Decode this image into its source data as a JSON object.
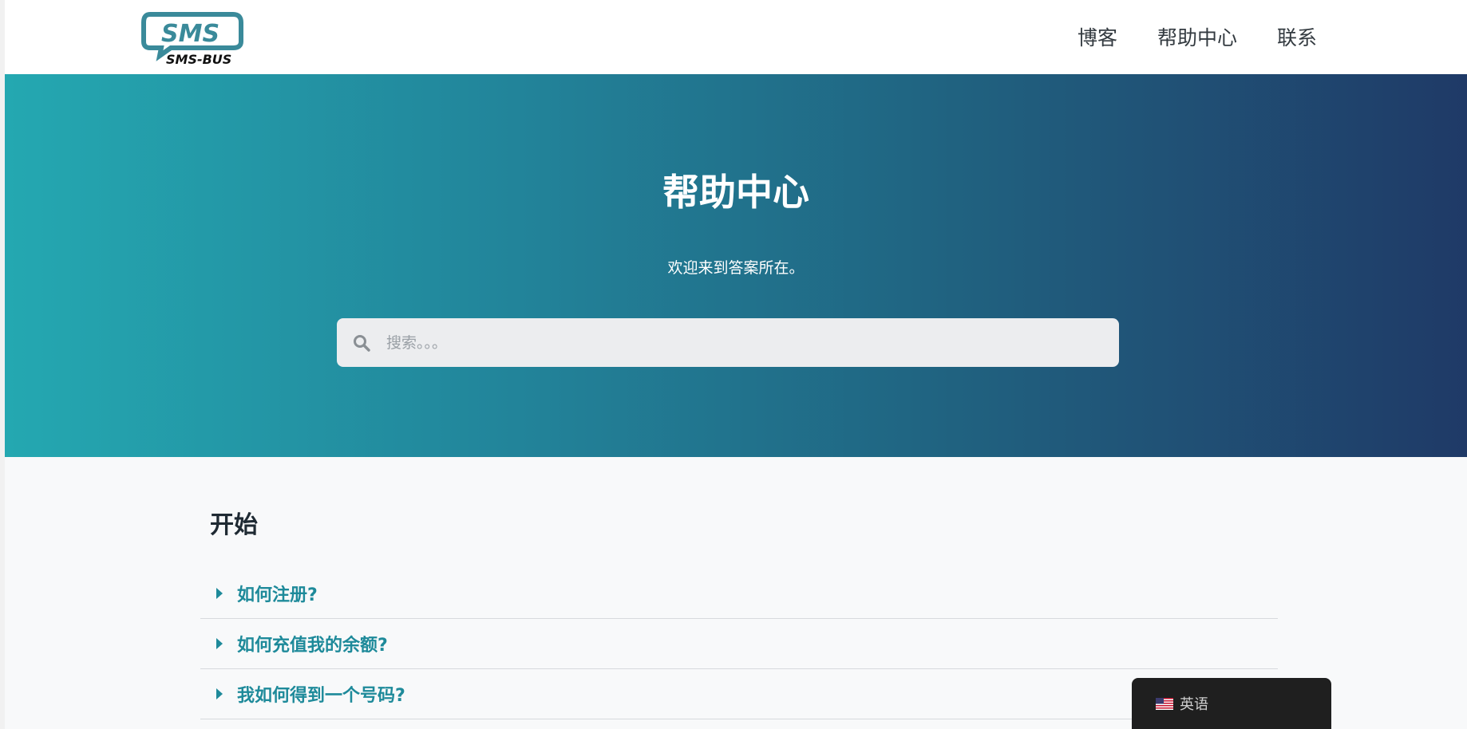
{
  "header": {
    "logo_text": "SMS",
    "logo_sub": "SMS-BUS",
    "nav": [
      {
        "label": "博客"
      },
      {
        "label": "帮助中心"
      },
      {
        "label": "联系"
      }
    ]
  },
  "hero": {
    "title": "帮助中心",
    "subtitle": "欢迎来到答案所在。",
    "search_placeholder": "搜索。。。"
  },
  "section": {
    "title": "开始",
    "faqs": [
      {
        "question": "如何注册?"
      },
      {
        "question": "如何充值我的余额?"
      },
      {
        "question": "我如何得到一个号码?"
      }
    ]
  },
  "language": {
    "label": "英语"
  },
  "colors": {
    "accent": "#1e8a9a",
    "gradient_start": "#24a8b1",
    "gradient_end": "#1f3a67"
  }
}
